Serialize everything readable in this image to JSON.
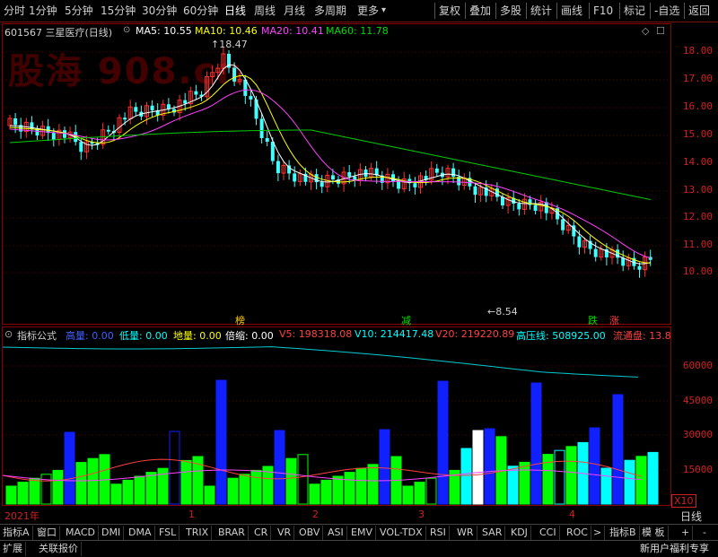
{
  "toolbar": {
    "left": [
      "分时",
      "1分钟",
      "5分钟",
      "15分钟",
      "30分钟",
      "60分钟",
      "日线",
      "周线",
      "月线",
      "多周期",
      "更多"
    ],
    "more_arrow": "▾",
    "right": [
      "复权",
      "叠加",
      "多股",
      "统计",
      "画线",
      "F10",
      "标记",
      "-自选",
      "返回"
    ]
  },
  "main": {
    "watermark": "股海 908.cn",
    "code_name": "601567 三星医疗(日线)",
    "ma5": "MA5: 10.55",
    "ma10": "MA10: 10.46",
    "ma20": "MA20: 10.41",
    "ma60": "MA60: 11.78",
    "high_mark": "18.47",
    "low_mark": "8.54",
    "y_ticks": [
      "18.00",
      "17.00",
      "16.00",
      "15.00",
      "14.00",
      "13.00",
      "12.00",
      "11.00",
      "10.00"
    ],
    "tags": [
      {
        "text": "榜",
        "color": "#ffcc00"
      },
      {
        "text": "减",
        "color": "#00dd00"
      },
      {
        "text": "跌",
        "color": "#00dd00"
      },
      {
        "text": "涨",
        "color": "#ff4040"
      }
    ]
  },
  "volume": {
    "title": "指标公式",
    "fields": [
      {
        "text": "高量: 0.00",
        "color": "#4060ff"
      },
      {
        "text": "低量: 0.00",
        "color": "#00ffff"
      },
      {
        "text": "地量: 0.00",
        "color": "#ffff00"
      },
      {
        "text": "倍缩: 0.00",
        "color": "#ffffff"
      },
      {
        "text": "V5: 198318.08",
        "color": "#ff4040"
      },
      {
        "text": "V10: 214417.48",
        "color": "#00ffff"
      },
      {
        "text": "V20: 219220.89",
        "color": "#ff4040"
      },
      {
        "text": "高压线: 508925.00",
        "color": "#00ffff"
      },
      {
        "text": "流通盘: 13.8",
        "color": "#ff4040"
      }
    ],
    "y_ticks": [
      "60000",
      "45000",
      "30000",
      "15000"
    ],
    "unit": "X10"
  },
  "dates": {
    "year": "2021年",
    "months": [
      "1",
      "2",
      "3",
      "4"
    ],
    "period": "日线"
  },
  "bottom_tabs": [
    "指标A",
    "窗口",
    "MACD",
    "DMI",
    "DMA",
    "FSL",
    "TRIX",
    "BRAR",
    "CR",
    "VR",
    "OBV",
    "ASI",
    "EMV",
    "VOL-TDX",
    "RSI",
    "WR",
    "SAR",
    "KDJ",
    "CCI",
    "ROC"
  ],
  "bottom_tabs_more": ">",
  "bottom_tabs_right": [
    "指标B",
    "模 板"
  ],
  "bottom_plus": "+",
  "bottom_minus": "-",
  "footer": {
    "left": [
      "扩展",
      "关联报价"
    ],
    "right": "新用户福利专享"
  }
}
